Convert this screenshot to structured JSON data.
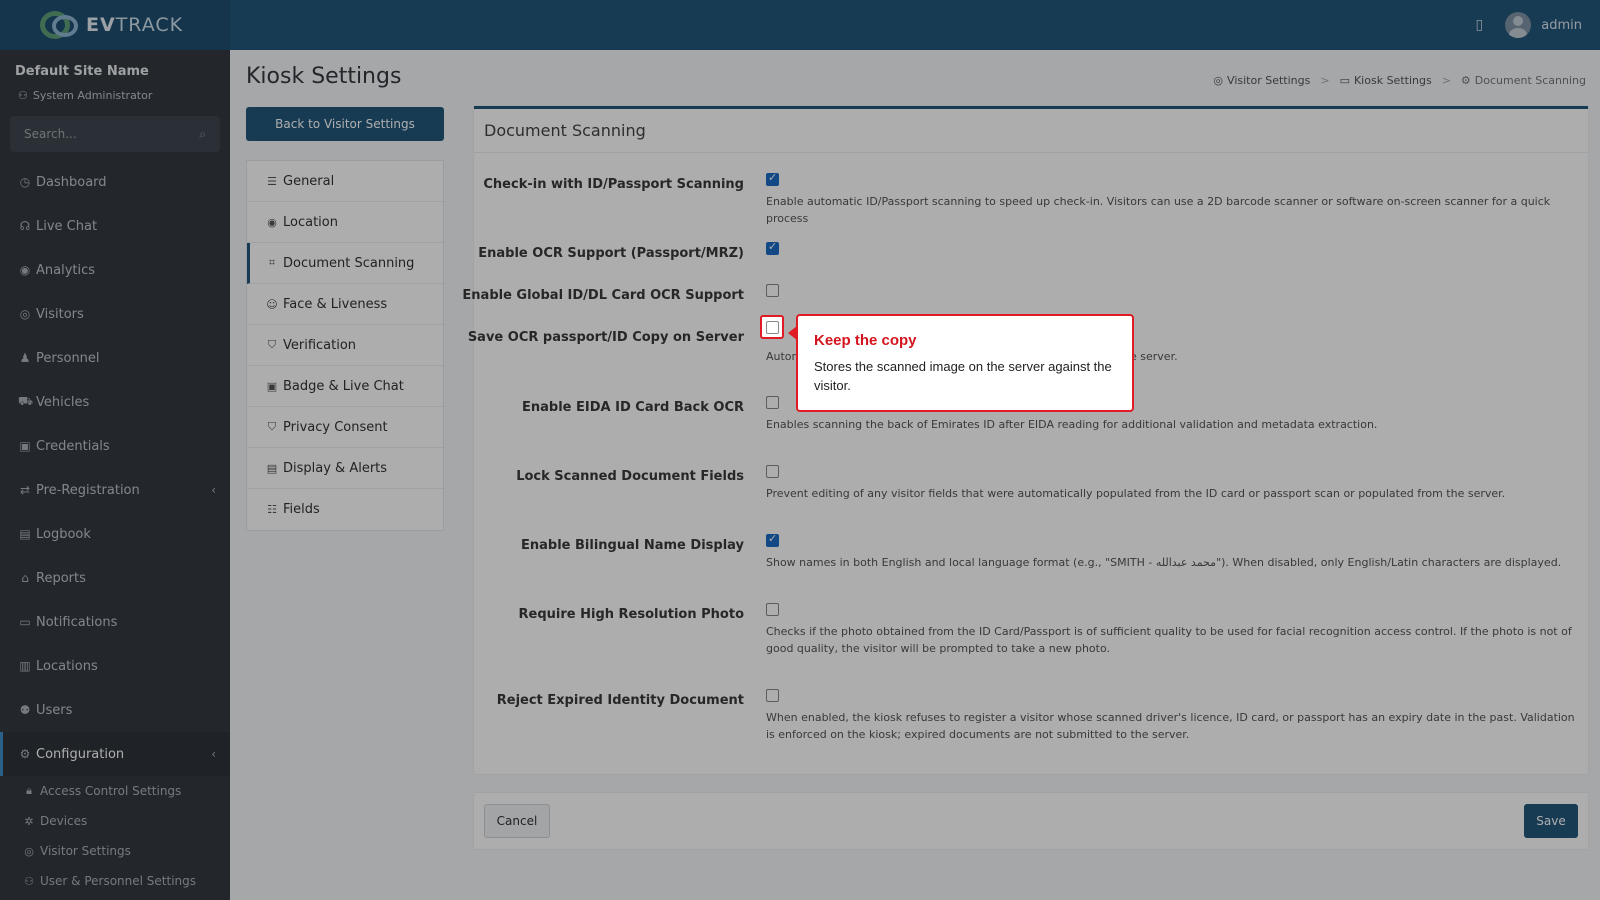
{
  "app": {
    "logo_prefix": "EV",
    "logo_suffix": "TRACK",
    "user_name": "admin"
  },
  "sidebar": {
    "site_name": "Default Site Name",
    "role": "System Administrator",
    "search_placeholder": "Search...",
    "items": [
      {
        "label": "Dashboard",
        "icon": "dashboard-icon"
      },
      {
        "label": "Live Chat",
        "icon": "headset-icon"
      },
      {
        "label": "Analytics",
        "icon": "analytics-icon"
      },
      {
        "label": "Visitors",
        "icon": "eye-icon"
      },
      {
        "label": "Personnel",
        "icon": "personnel-icon"
      },
      {
        "label": "Vehicles",
        "icon": "car-icon"
      },
      {
        "label": "Credentials",
        "icon": "id-card-icon"
      },
      {
        "label": "Pre-Registration",
        "icon": "arrows-icon"
      },
      {
        "label": "Logbook",
        "icon": "book-icon"
      },
      {
        "label": "Reports",
        "icon": "reports-icon"
      },
      {
        "label": "Notifications",
        "icon": "bell-icon"
      },
      {
        "label": "Locations",
        "icon": "map-icon"
      },
      {
        "label": "Users",
        "icon": "users-icon"
      },
      {
        "label": "Configuration",
        "icon": "gear-icon"
      }
    ],
    "sub_items": [
      {
        "label": "Access Control Settings",
        "icon": "lock-icon"
      },
      {
        "label": "Devices",
        "icon": "cog-icon"
      },
      {
        "label": "Visitor Settings",
        "icon": "eye-icon"
      },
      {
        "label": "User & Personnel Settings",
        "icon": "user-cog-icon"
      }
    ]
  },
  "page": {
    "title": "Kiosk Settings",
    "back_label": "Back to Visitor Settings",
    "breadcrumb": [
      "Visitor Settings",
      "Kiosk Settings",
      "Document Scanning"
    ]
  },
  "settings_menu": [
    {
      "label": "General",
      "icon": "sliders-icon"
    },
    {
      "label": "Location",
      "icon": "location-pin-icon"
    },
    {
      "label": "Document Scanning",
      "icon": "scan-icon"
    },
    {
      "label": "Face & Liveness",
      "icon": "face-icon"
    },
    {
      "label": "Verification",
      "icon": "shield-check-icon"
    },
    {
      "label": "Badge & Live Chat",
      "icon": "badge-icon"
    },
    {
      "label": "Privacy Consent",
      "icon": "privacy-shield-icon"
    },
    {
      "label": "Display & Alerts",
      "icon": "display-icon"
    },
    {
      "label": "Fields",
      "icon": "list-check-icon"
    }
  ],
  "card": {
    "title": "Document Scanning",
    "rows": [
      {
        "label": "Check-in with ID/Passport Scanning",
        "checked": true,
        "desc": "Enable automatic ID/Passport scanning to speed up check-in. Visitors can use a 2D barcode scanner or software on-screen scanner for a quick process"
      },
      {
        "label": "Enable OCR Support (Passport/MRZ)",
        "checked": true,
        "desc": ""
      },
      {
        "label": "Enable Global ID/DL Card OCR Support",
        "checked": false,
        "desc": ""
      },
      {
        "label": "Save OCR passport/ID Copy on Server",
        "checked": false,
        "desc_start": "Autor",
        "desc_end": "e server."
      },
      {
        "label": "Enable EIDA ID Card Back OCR",
        "checked": false,
        "desc": "Enables scanning the back of Emirates ID after EIDA reading for additional validation and metadata extraction."
      },
      {
        "label": "Lock Scanned Document Fields",
        "checked": false,
        "desc": "Prevent editing of any visitor fields that were automatically populated from the ID card or passport scan or populated from the server."
      },
      {
        "label": "Enable Bilingual Name Display",
        "checked": true,
        "desc": "Show names in both English and local language format (e.g., \"SMITH - محمد عبدالله\"). When disabled, only English/Latin characters are displayed."
      },
      {
        "label": "Require High Resolution Photo",
        "checked": false,
        "desc": "Checks if the photo obtained from the ID Card/Passport is of sufficient quality to be used for facial recognition access control. If the photo is not of good quality, the visitor will be prompted to take a new photo."
      },
      {
        "label": "Reject Expired Identity Document",
        "checked": false,
        "desc": "When enabled, the kiosk refuses to register a visitor whose scanned driver's licence, ID card, or passport has an expiry date in the past. Validation is enforced on the kiosk; expired documents are not submitted to the server."
      }
    ]
  },
  "footer": {
    "cancel_label": "Cancel",
    "save_label": "Save"
  },
  "tooltip": {
    "title": "Keep the copy",
    "body": "Stores the scanned image on the server against the visitor."
  },
  "colors": {
    "brand": "#24577c",
    "highlight": "#e01b24",
    "checkbox": "#1a6bc4"
  }
}
